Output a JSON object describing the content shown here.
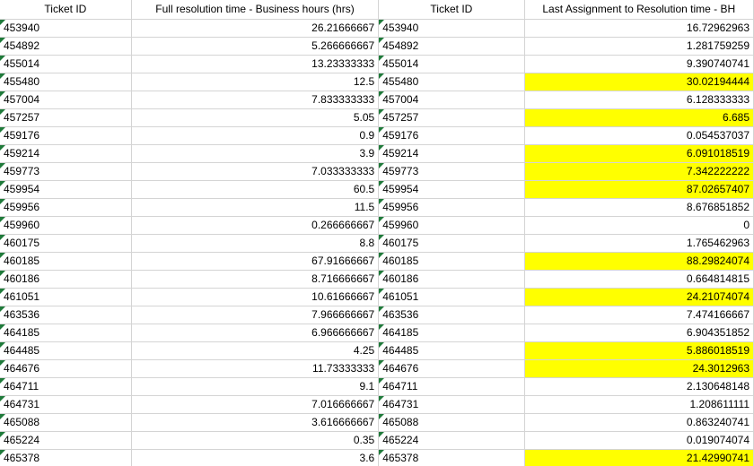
{
  "columns": [
    "Ticket ID",
    "Full resolution time - Business hours (hrs)",
    "Ticket ID",
    "Last Assignment to Resolution time - BH"
  ],
  "highlight_color": "#ffff00",
  "text_number_marker_color": "#1f7a3a",
  "rows": [
    {
      "id": "453940",
      "full": "26.21666667",
      "id2": "453940",
      "last": "16.72962963",
      "hl": false
    },
    {
      "id": "454892",
      "full": "5.266666667",
      "id2": "454892",
      "last": "1.281759259",
      "hl": false
    },
    {
      "id": "455014",
      "full": "13.23333333",
      "id2": "455014",
      "last": "9.390740741",
      "hl": false
    },
    {
      "id": "455480",
      "full": "12.5",
      "id2": "455480",
      "last": "30.02194444",
      "hl": true
    },
    {
      "id": "457004",
      "full": "7.833333333",
      "id2": "457004",
      "last": "6.128333333",
      "hl": false
    },
    {
      "id": "457257",
      "full": "5.05",
      "id2": "457257",
      "last": "6.685",
      "hl": true
    },
    {
      "id": "459176",
      "full": "0.9",
      "id2": "459176",
      "last": "0.054537037",
      "hl": false
    },
    {
      "id": "459214",
      "full": "3.9",
      "id2": "459214",
      "last": "6.091018519",
      "hl": true
    },
    {
      "id": "459773",
      "full": "7.033333333",
      "id2": "459773",
      "last": "7.342222222",
      "hl": true
    },
    {
      "id": "459954",
      "full": "60.5",
      "id2": "459954",
      "last": "87.02657407",
      "hl": true
    },
    {
      "id": "459956",
      "full": "11.5",
      "id2": "459956",
      "last": "8.676851852",
      "hl": false
    },
    {
      "id": "459960",
      "full": "0.266666667",
      "id2": "459960",
      "last": "0",
      "hl": false
    },
    {
      "id": "460175",
      "full": "8.8",
      "id2": "460175",
      "last": "1.765462963",
      "hl": false
    },
    {
      "id": "460185",
      "full": "67.91666667",
      "id2": "460185",
      "last": "88.29824074",
      "hl": true
    },
    {
      "id": "460186",
      "full": "8.716666667",
      "id2": "460186",
      "last": "0.664814815",
      "hl": false
    },
    {
      "id": "461051",
      "full": "10.61666667",
      "id2": "461051",
      "last": "24.21074074",
      "hl": true
    },
    {
      "id": "463536",
      "full": "7.966666667",
      "id2": "463536",
      "last": "7.474166667",
      "hl": false
    },
    {
      "id": "464185",
      "full": "6.966666667",
      "id2": "464185",
      "last": "6.904351852",
      "hl": false
    },
    {
      "id": "464485",
      "full": "4.25",
      "id2": "464485",
      "last": "5.886018519",
      "hl": true
    },
    {
      "id": "464676",
      "full": "11.73333333",
      "id2": "464676",
      "last": "24.3012963",
      "hl": true
    },
    {
      "id": "464711",
      "full": "9.1",
      "id2": "464711",
      "last": "2.130648148",
      "hl": false
    },
    {
      "id": "464731",
      "full": "7.016666667",
      "id2": "464731",
      "last": "1.208611111",
      "hl": false
    },
    {
      "id": "465088",
      "full": "3.616666667",
      "id2": "465088",
      "last": "0.863240741",
      "hl": false
    },
    {
      "id": "465224",
      "full": "0.35",
      "id2": "465224",
      "last": "0.019074074",
      "hl": false
    },
    {
      "id": "465378",
      "full": "3.6",
      "id2": "465378",
      "last": "21.42990741",
      "hl": true
    }
  ]
}
